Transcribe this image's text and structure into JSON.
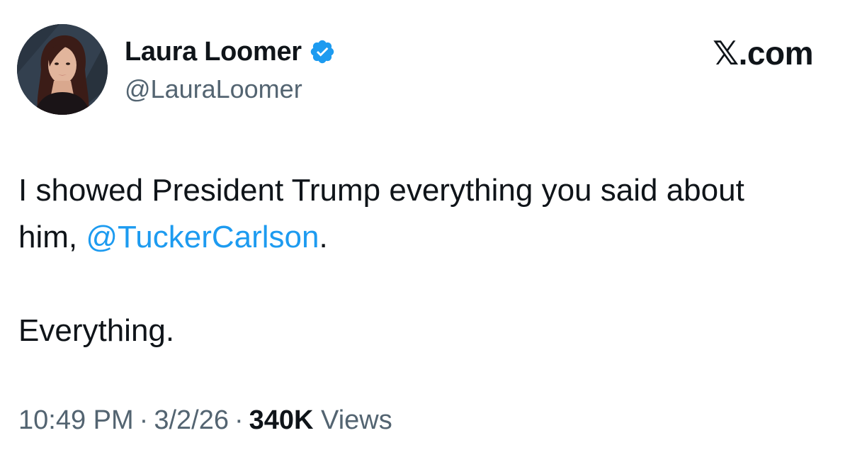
{
  "author": {
    "display_name": "Laura Loomer",
    "handle": "@LauraLoomer",
    "verified": true,
    "verified_color": "#1d9bf0"
  },
  "site_logo": "𝕏.com",
  "tweet": {
    "line1": "I showed President Trump everything you said about",
    "line2_prefix": "him, ",
    "mention": "@TuckerCarlson",
    "line2_suffix": ".",
    "line3": "Everything."
  },
  "meta": {
    "time": "10:49 PM",
    "separator": "·",
    "date": "3/2/26",
    "views_count": "340K",
    "views_label": "Views"
  },
  "colors": {
    "text": "#0f1419",
    "secondary": "#536471",
    "link": "#1d9bf0",
    "background": "#ffffff"
  },
  "icons": {
    "verified": "verified-badge-icon",
    "avatar": "profile-photo"
  }
}
